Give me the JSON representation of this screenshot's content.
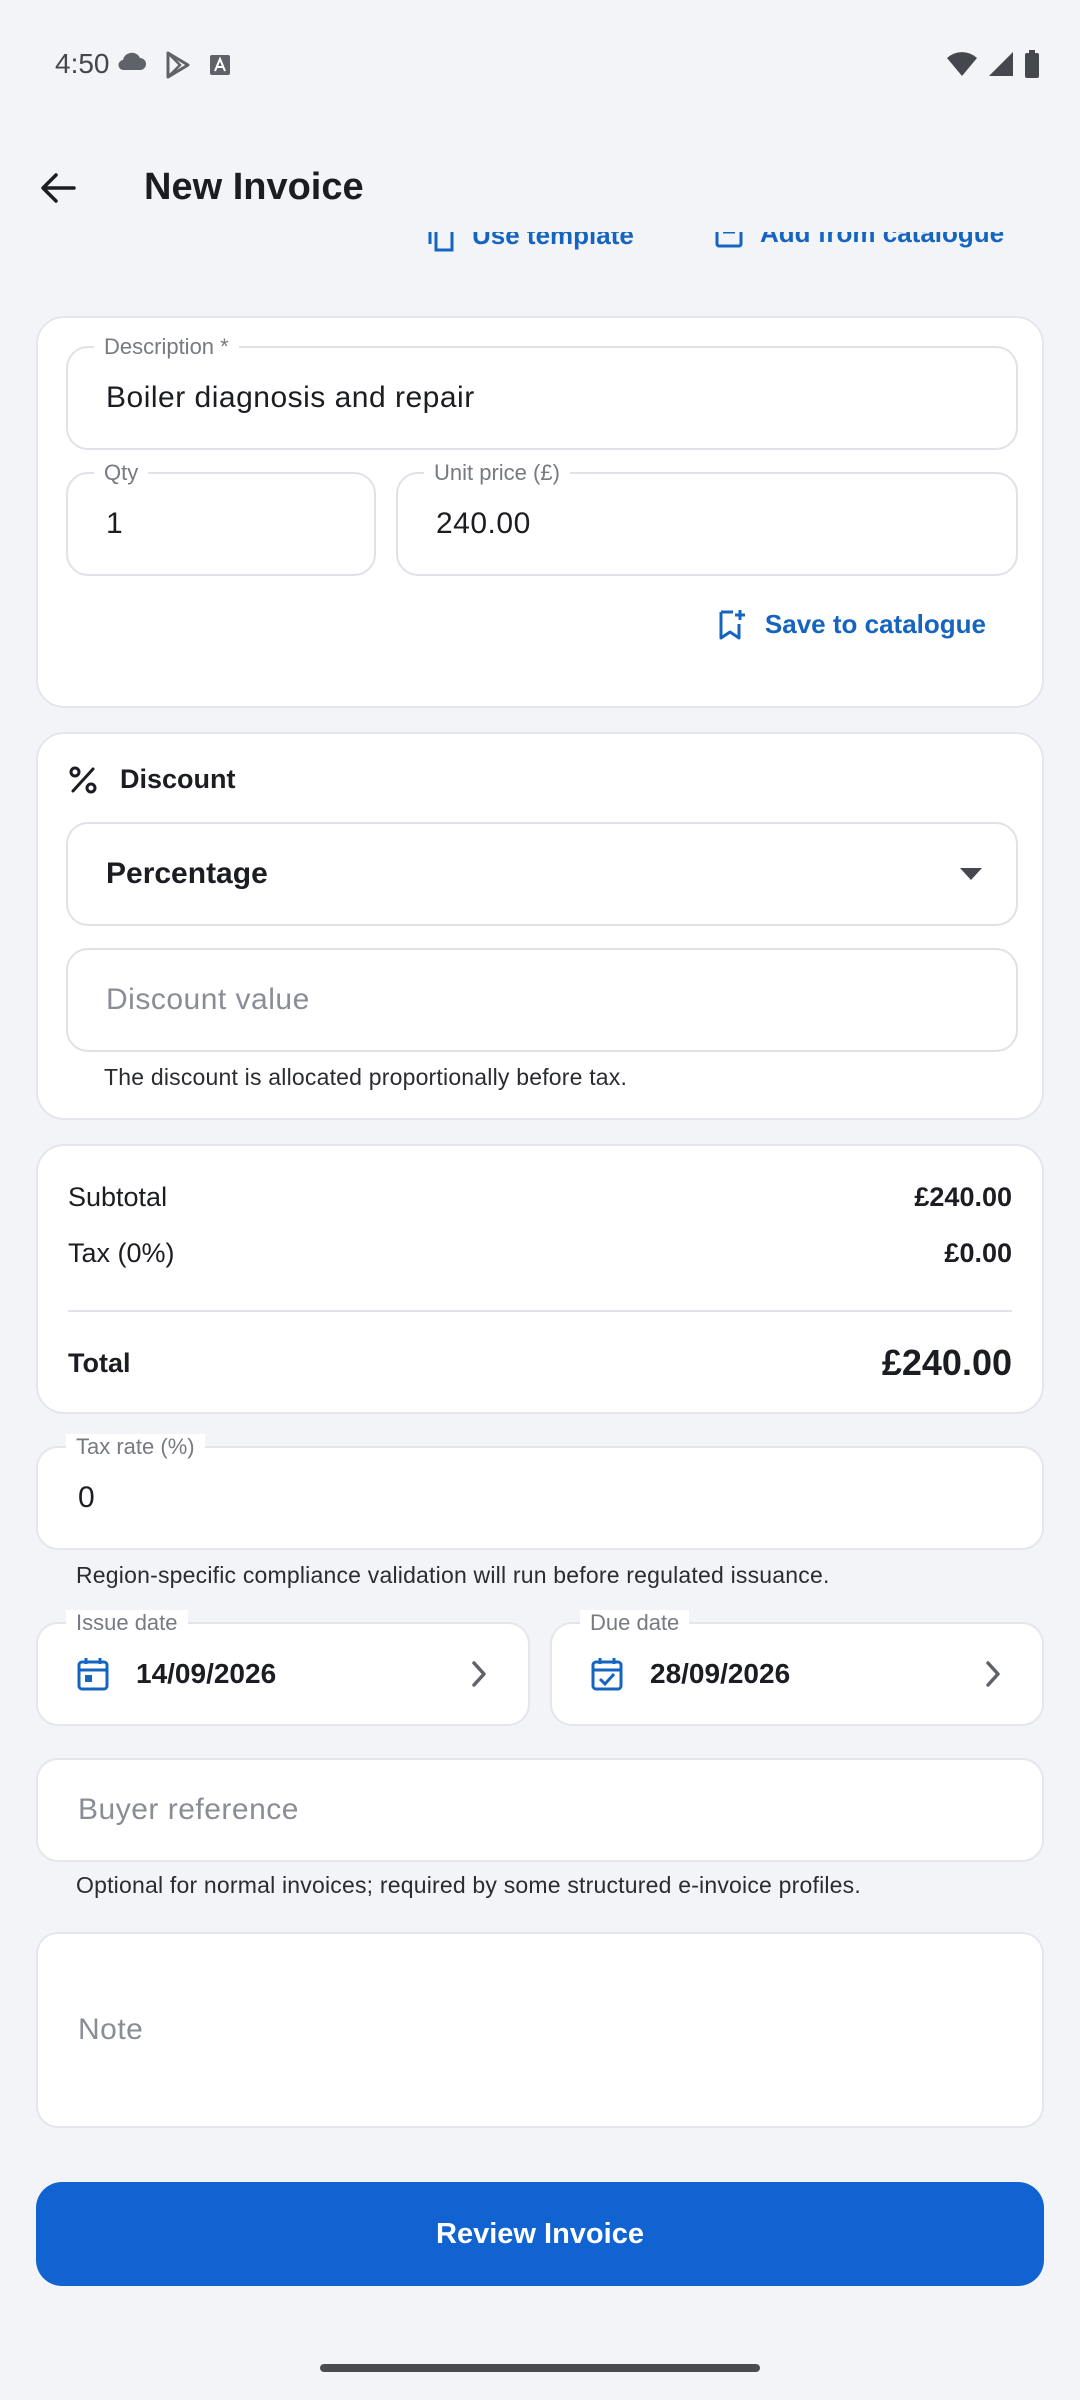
{
  "status_bar": {
    "time": "4:50"
  },
  "app_bar": {
    "title": "New Invoice"
  },
  "top_actions": {
    "use_template": "Use template",
    "add_from_catalogue": "Add from catalogue"
  },
  "line_item": {
    "description_label": "Description *",
    "description_value": "Boiler diagnosis and repair",
    "qty_label": "Qty",
    "qty_value": "1",
    "unit_price_label": "Unit price (£)",
    "unit_price_value": "240.00",
    "save_to_catalogue": "Save to catalogue"
  },
  "discount": {
    "title": "Discount",
    "type_selected": "Percentage",
    "value_placeholder": "Discount value",
    "helper": "The discount is allocated proportionally before tax."
  },
  "summary": {
    "subtotal_label": "Subtotal",
    "subtotal_value": "£240.00",
    "tax_label": "Tax (0%)",
    "tax_value": "£0.00",
    "total_label": "Total",
    "total_value": "£240.00"
  },
  "tax_rate": {
    "label": "Tax rate (%)",
    "value": "0",
    "helper": "Region-specific compliance validation will run before regulated issuance."
  },
  "dates": {
    "issue_label": "Issue date",
    "issue_value": "14/09/2026",
    "due_label": "Due date",
    "due_value": "28/09/2026"
  },
  "buyer_reference": {
    "placeholder": "Buyer reference",
    "helper": "Optional for normal invoices; required by some structured e-invoice profiles."
  },
  "note": {
    "placeholder": "Note"
  },
  "primary_button": {
    "label": "Review Invoice"
  },
  "colors": {
    "accent": "#1063d1",
    "link": "#1565c0",
    "background": "#f3f4f8"
  }
}
